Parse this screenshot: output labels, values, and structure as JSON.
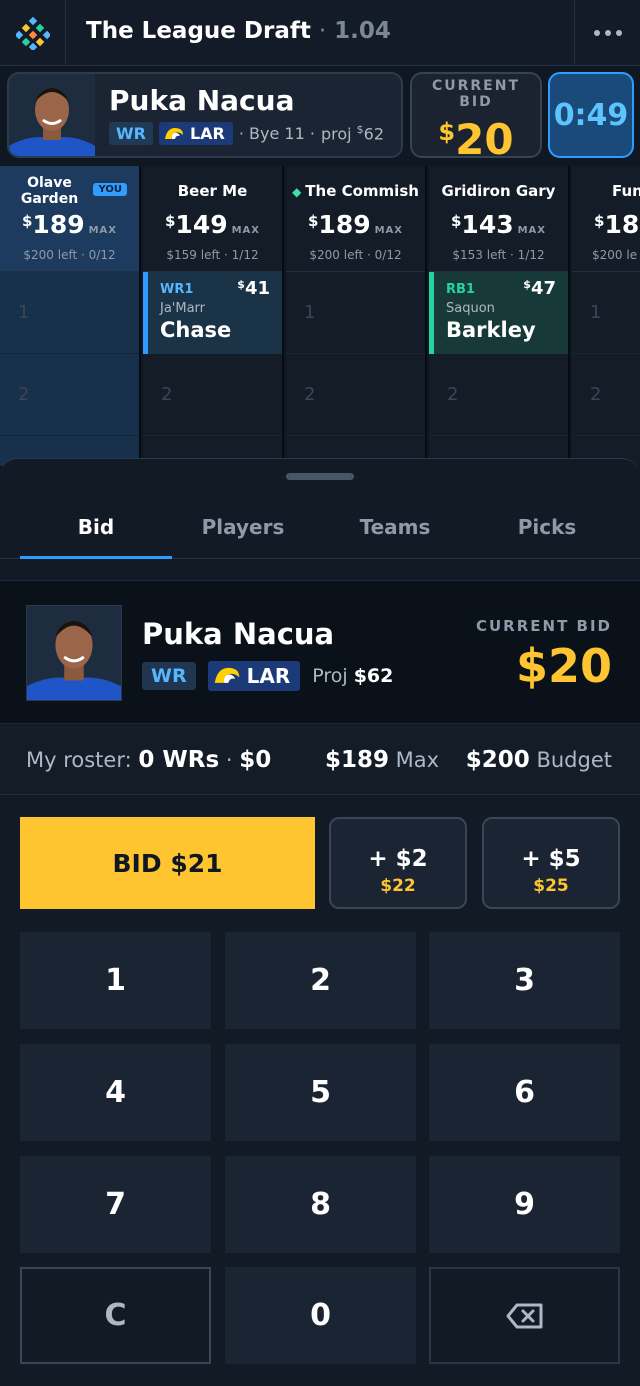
{
  "header": {
    "title": "The League Draft",
    "separator": "·",
    "pick": "1.04",
    "menu_icon": "more-horizontal-icon"
  },
  "nomination": {
    "player_name": "Puka Nacua",
    "position": "WR",
    "team": "LAR",
    "bye": "· Bye 11 ·",
    "proj_label": "proj",
    "proj_symbol": "$",
    "proj_value": "62",
    "bid_label_1": "CURRENT",
    "bid_label_2": "BID",
    "bid_symbol": "$",
    "bid_value": "20",
    "timer": "0:49"
  },
  "teams": [
    {
      "name": "Olave Garden",
      "you_tag": "YOU",
      "max_symbol": "$",
      "max": "189",
      "max_label": "MAX",
      "sub": "$200 left · 0/12",
      "slot_1": "1",
      "slot_2": "2"
    },
    {
      "name": "Beer Me",
      "max_symbol": "$",
      "max": "149",
      "max_label": "MAX",
      "sub": "$159 left · 1/12",
      "slot_2": "2",
      "pick": {
        "pos": "WR1",
        "price_symbol": "$",
        "price": "41",
        "first": "Ja'Marr",
        "last": "Chase"
      }
    },
    {
      "name": "The Commish",
      "max_symbol": "$",
      "max": "189",
      "max_label": "MAX",
      "sub": "$200 left · 0/12",
      "slot_1": "1",
      "slot_2": "2"
    },
    {
      "name": "Gridiron Gary",
      "max_symbol": "$",
      "max": "143",
      "max_label": "MAX",
      "sub": "$153 left · 1/12",
      "slot_2": "2",
      "pick": {
        "pos": "RB1",
        "price_symbol": "$",
        "price": "47",
        "first": "Saquon",
        "last": "Barkley"
      }
    },
    {
      "name": "Fun",
      "max_symbol": "$",
      "max": "18",
      "sub": "$200 le",
      "slot_1": "1",
      "slot_2": "2"
    }
  ],
  "tabs": [
    "Bid",
    "Players",
    "Teams",
    "Picks"
  ],
  "panel": {
    "player_name": "Puka Nacua",
    "position": "WR",
    "team": "LAR",
    "proj_label": "Proj",
    "proj_value": "$62",
    "bid_label": "CURRENT BID",
    "bid_value": "$20"
  },
  "roster": {
    "label": "My roster:",
    "count": "0 WRs",
    "dot": "·",
    "spent": "$0",
    "max_value": "$189",
    "max_label": "Max",
    "budget_value": "$200",
    "budget_label": "Budget"
  },
  "bid_buttons": {
    "main": "BID $21",
    "inc_2_label": "+ $2",
    "inc_2_total": "$22",
    "inc_5_label": "+ $5",
    "inc_5_total": "$25"
  },
  "keypad": [
    "1",
    "2",
    "3",
    "4",
    "5",
    "6",
    "7",
    "8",
    "9",
    "C",
    "0"
  ],
  "colors": {
    "accent_blue": "#2f9dff",
    "bid_yellow": "#ffc531",
    "rb_green": "#28d1a0",
    "background": "#0f1722"
  }
}
